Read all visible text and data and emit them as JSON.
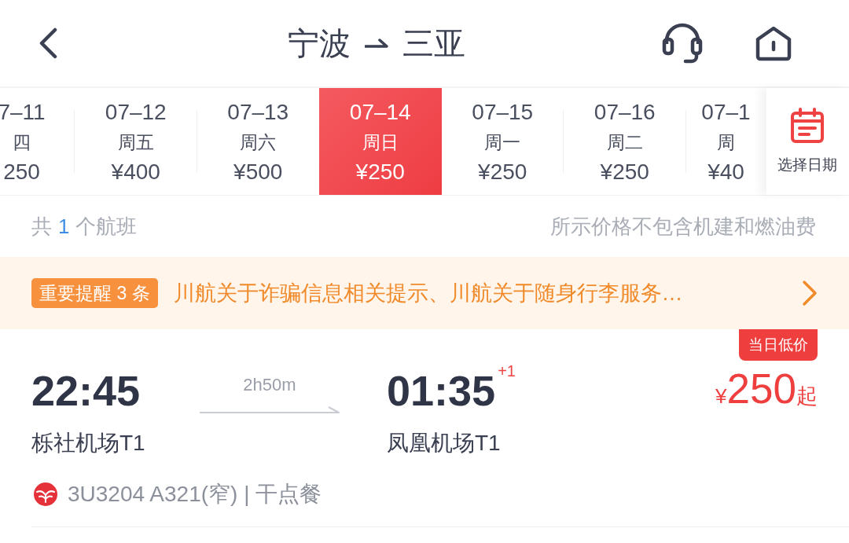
{
  "nav": {
    "from": "宁波",
    "to": "三亚"
  },
  "date_strip": {
    "dates": [
      {
        "date": "7–11",
        "weekday": "四",
        "price": "250",
        "selected": false
      },
      {
        "date": "07–12",
        "weekday": "周五",
        "price": "¥400",
        "selected": false
      },
      {
        "date": "07–13",
        "weekday": "周六",
        "price": "¥500",
        "selected": false
      },
      {
        "date": "07–14",
        "weekday": "周日",
        "price": "¥250",
        "selected": true
      },
      {
        "date": "07–15",
        "weekday": "周一",
        "price": "¥250",
        "selected": false
      },
      {
        "date": "07–16",
        "weekday": "周二",
        "price": "¥250",
        "selected": false
      },
      {
        "date": "07–1",
        "weekday": "周",
        "price": "¥40",
        "selected": false
      }
    ],
    "calendar_label": "选择日期"
  },
  "summary": {
    "prefix": "共",
    "count": "1",
    "suffix": "个航班",
    "note": "所示价格不包含机建和燃油费"
  },
  "notice": {
    "badge": "重要提醒 3 条",
    "text": "川航关于诈骗信息相关提示、川航关于随身行李服务…"
  },
  "flights": [
    {
      "badge": "当日低价",
      "depart_time": "22:45",
      "duration": "2h50m",
      "arrive_time": "01:35",
      "day_offset": "+1",
      "price": {
        "currency": "¥",
        "amount": "250",
        "suffix": "起"
      },
      "depart_airport": "栎社机场T1",
      "arrive_airport": "凤凰机场T1",
      "flight_info": "3U3204 A321(窄) | 干点餐"
    }
  ]
}
